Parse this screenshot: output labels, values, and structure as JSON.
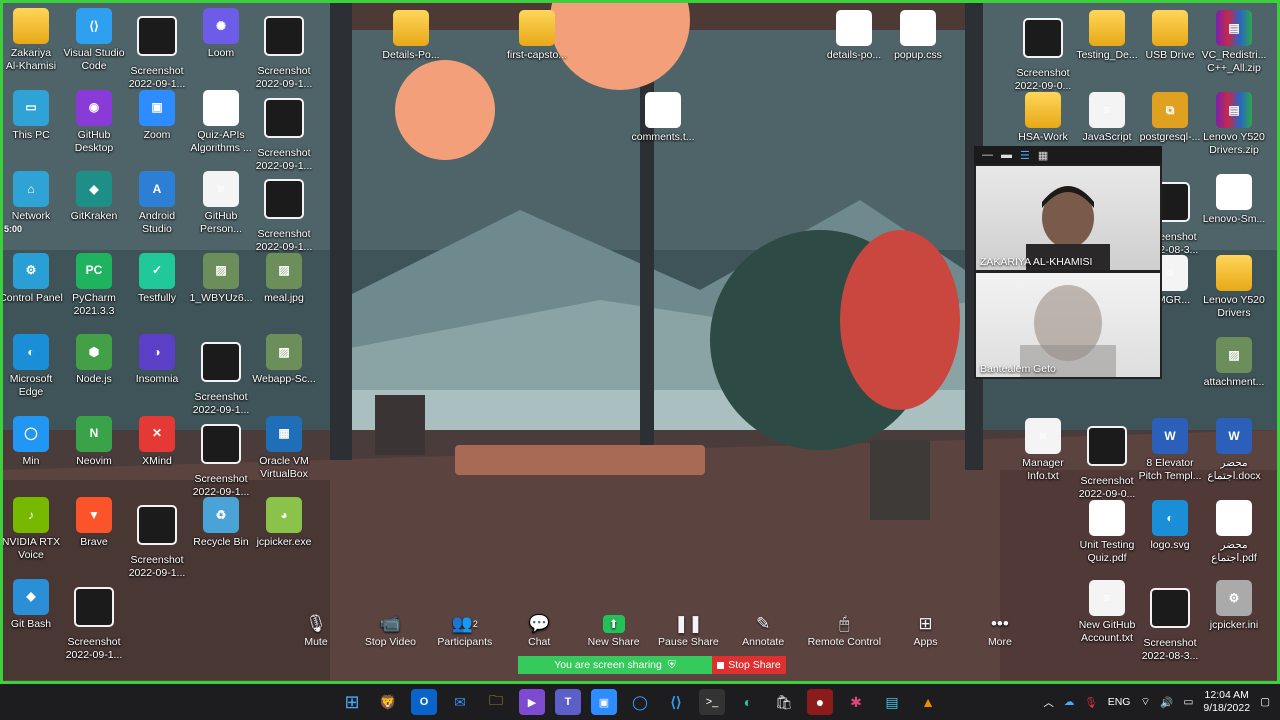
{
  "desktop": {
    "left_icons": [
      {
        "label": "Zakariya\nAl-Khamisi",
        "icon": "user-folder-icon"
      },
      {
        "label": "Visual Studio\nCode",
        "icon": "vscode-icon"
      },
      {
        "label": "Screenshot\n2022-09-1...",
        "icon": "screenshot-icon"
      },
      {
        "label": "Loom",
        "icon": "loom-icon"
      },
      {
        "label": "Screenshot\n2022-09-1...",
        "icon": "screenshot-icon"
      },
      {
        "label": "This PC",
        "icon": "this-pc-icon"
      },
      {
        "label": "GitHub\nDesktop",
        "icon": "github-icon"
      },
      {
        "label": "Zoom",
        "icon": "zoom-icon"
      },
      {
        "label": "Quiz-APIs\nAlgorithms ...",
        "icon": "pdf-icon"
      },
      {
        "label": "Screenshot\n2022-09-1...",
        "icon": "screenshot-icon"
      },
      {
        "label": "Network",
        "icon": "network-icon"
      },
      {
        "label": "GitKraken",
        "icon": "gitkraken-icon"
      },
      {
        "label": "Android\nStudio",
        "icon": "android-studio-icon"
      },
      {
        "label": "GitHub\nPerson...",
        "icon": "document-icon"
      },
      {
        "label": "Screenshot\n2022-09-1...",
        "icon": "screenshot-icon"
      },
      {
        "label": "Control Panel",
        "icon": "control-panel-icon"
      },
      {
        "label": "PyCharm\n2021.3.3",
        "icon": "pycharm-icon"
      },
      {
        "label": "Testfully",
        "icon": "testfully-icon"
      },
      {
        "label": "1_WBYUz6...",
        "icon": "image-icon"
      },
      {
        "label": "meal.jpg",
        "icon": "image-icon"
      },
      {
        "label": "Microsoft\nEdge",
        "icon": "edge-icon"
      },
      {
        "label": "Node.js",
        "icon": "nodejs-icon"
      },
      {
        "label": "Insomnia",
        "icon": "insomnia-icon"
      },
      {
        "label": "Screenshot\n2022-09-1...",
        "icon": "screenshot-icon"
      },
      {
        "label": "Webapp-Sc...",
        "icon": "image-icon"
      },
      {
        "label": "Min",
        "icon": "min-browser-icon"
      },
      {
        "label": "Neovim",
        "icon": "neovim-icon"
      },
      {
        "label": "XMind",
        "icon": "xmind-icon"
      },
      {
        "label": "Screenshot\n2022-09-1...",
        "icon": "screenshot-icon"
      },
      {
        "label": "Oracle VM\nVirtualBox",
        "icon": "virtualbox-icon"
      },
      {
        "label": "NVIDIA RTX\nVoice",
        "icon": "nvidia-icon"
      },
      {
        "label": "Brave",
        "icon": "brave-icon"
      },
      {
        "label": "Screenshot\n2022-09-1...",
        "icon": "screenshot-icon"
      },
      {
        "label": "Recycle Bin",
        "icon": "recycle-bin-icon"
      },
      {
        "label": "jcpicker.exe",
        "icon": "jcpicker-icon"
      },
      {
        "label": "Git Bash",
        "icon": "git-bash-icon"
      },
      {
        "label": "Screenshot\n2022-09-1...",
        "icon": "screenshot-icon"
      }
    ],
    "center_icons": [
      {
        "label": "Details-Po...",
        "icon": "folder-icon"
      },
      {
        "label": "first-capsto...",
        "icon": "folder-icon"
      },
      {
        "label": "details-po...",
        "icon": "js-file-icon"
      },
      {
        "label": "popup.css",
        "icon": "css-file-icon"
      },
      {
        "label": "comments.t...",
        "icon": "js-file-icon"
      }
    ],
    "right_icons": [
      {
        "label": "Screenshot\n2022-09-0...",
        "icon": "screenshot-icon"
      },
      {
        "label": "Testing_De...",
        "icon": "folder-icon"
      },
      {
        "label": "USB Drive",
        "icon": "folder-icon"
      },
      {
        "label": "VC_Redistri...\nC++_All.zip",
        "icon": "archive-icon"
      },
      {
        "label": "HSA-Work",
        "icon": "folder-icon"
      },
      {
        "label": "JavaScript",
        "icon": "document-icon"
      },
      {
        "label": "postgresql-...",
        "icon": "installer-icon"
      },
      {
        "label": "Lenovo Y520\nDrivers.zip",
        "icon": "archive-icon"
      },
      {
        "label": "Screenshot\n2022-08-3...",
        "icon": "screenshot-icon"
      },
      {
        "label": "Lenovo-Sm...",
        "icon": "pdf-icon"
      },
      {
        "label": "VMGR...",
        "icon": "document-icon"
      },
      {
        "label": "Lenovo Y520\nDrivers",
        "icon": "folder-icon"
      },
      {
        "label": "attachment...",
        "icon": "image-icon"
      },
      {
        "label": "Manager\nInfo.txt",
        "icon": "document-icon"
      },
      {
        "label": "Screenshot\n2022-09-0...",
        "icon": "screenshot-icon"
      },
      {
        "label": "8 Elevator\nPitch Templ...",
        "icon": "word-icon"
      },
      {
        "label": "محضر\nاجتماع.docx",
        "icon": "word-icon"
      },
      {
        "label": "Unit Testing\nQuiz.pdf",
        "icon": "pdf-icon"
      },
      {
        "label": "logo.svg",
        "icon": "edge-icon"
      },
      {
        "label": "محضر\nاجتماع.pdf",
        "icon": "pdf-icon"
      },
      {
        "label": "New GitHub\nAccount.txt",
        "icon": "document-icon"
      },
      {
        "label": "Screenshot\n2022-08-3...",
        "icon": "screenshot-icon"
      },
      {
        "label": "jcpicker.ini",
        "icon": "settings-file-icon"
      }
    ],
    "timer_label": "5:00"
  },
  "participants": {
    "first_name": "ZAKARIYA AL-KHAMISI",
    "second_name": "Bantealem Geto"
  },
  "zoom_toolbar": {
    "items": [
      {
        "label": "Mute",
        "icon": "microphone-icon"
      },
      {
        "label": "Stop Video",
        "icon": "video-camera-icon"
      },
      {
        "label": "Participants",
        "icon": "participants-icon",
        "count": "2"
      },
      {
        "label": "Chat",
        "icon": "chat-icon"
      },
      {
        "label": "New Share",
        "icon": "share-screen-icon"
      },
      {
        "label": "Pause Share",
        "icon": "pause-icon"
      },
      {
        "label": "Annotate",
        "icon": "pencil-icon"
      },
      {
        "label": "Remote Control",
        "icon": "mouse-icon"
      },
      {
        "label": "Apps",
        "icon": "apps-icon"
      },
      {
        "label": "More",
        "icon": "more-icon"
      }
    ],
    "sharing_status": "You are screen sharing",
    "stop_share_label": "Stop Share"
  },
  "taskbar": {
    "language": "ENG",
    "time": "12:04 AM",
    "date": "9/18/2022"
  },
  "colors": {
    "share_border": "#3cd13c",
    "share_banner": "#36c95c",
    "stop_share": "#df2f2f",
    "taskbar": "#1d1d1f"
  }
}
